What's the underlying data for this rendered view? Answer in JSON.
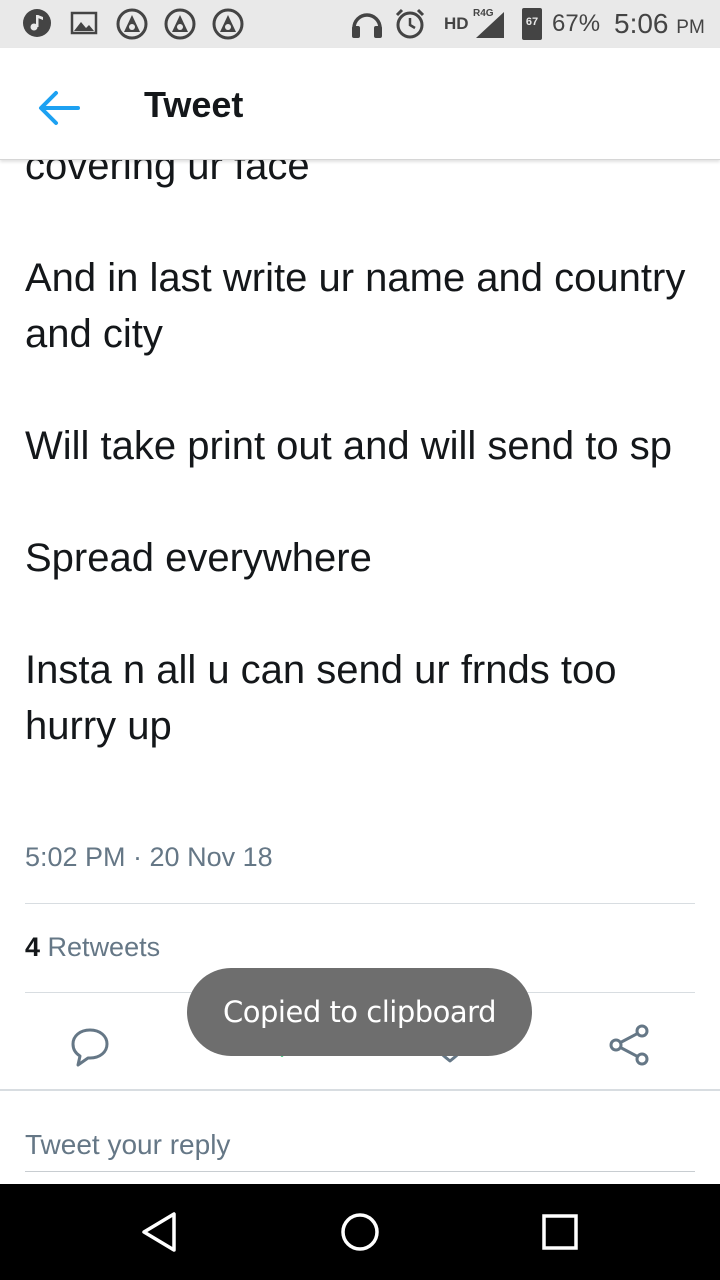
{
  "status_bar": {
    "network": "HD",
    "network_type": "R4G",
    "battery_level": "67",
    "battery_percent": "67%",
    "time": "5:06",
    "time_suffix": "PM",
    "icons": [
      "music-icon",
      "image-icon",
      "app-notification-icon",
      "app-notification-icon",
      "app-notification-icon",
      "headset-icon",
      "alarm-icon",
      "signal-icon",
      "battery-icon"
    ]
  },
  "app_bar": {
    "title": "Tweet",
    "back_icon": "arrow-left-icon"
  },
  "tweet": {
    "paragraphs": [
      "covering ur face",
      "And in last write ur name and country and city",
      "Will take print out and will send to sp",
      "Spread everywhere",
      "Insta n all u can send ur frnds too hurry up"
    ],
    "timestamp": "5:02 PM · 20 Nov 18",
    "retweet_count": "4",
    "retweet_label": "Retweets"
  },
  "actions": {
    "reply_icon": "reply-icon",
    "retweet_icon": "retweet-icon",
    "like_icon": "heart-icon",
    "share_icon": "share-icon"
  },
  "toast": {
    "message": "Copied to clipboard"
  },
  "reply": {
    "placeholder": "Tweet your reply"
  },
  "nav_bar": {
    "icons": [
      "back-triangle-icon",
      "home-circle-icon",
      "recents-square-icon"
    ]
  },
  "colors": {
    "accent": "#1da1f2",
    "text": "#14171a",
    "secondary_text": "#657786",
    "retweet_green": "#17bf63",
    "toast_bg": "#6e6e6e"
  }
}
